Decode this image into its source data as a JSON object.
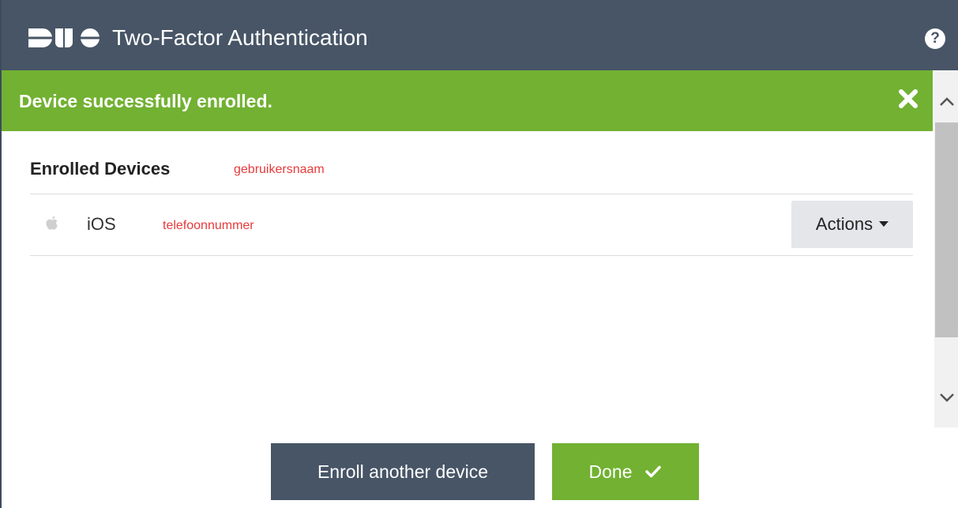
{
  "header": {
    "logo_text": "DUO",
    "title": "Two-Factor Authentication",
    "help_icon": "question-circle-icon",
    "help_symbol": "?"
  },
  "notification": {
    "message": "Device successfully enrolled.",
    "close_icon": "close-icon"
  },
  "devices": {
    "heading": "Enrolled Devices",
    "username_note": "gebruikersnaam",
    "items": [
      {
        "icon": "apple-icon",
        "name": "iOS",
        "note": "telefoonnummer",
        "actions_label": "Actions"
      }
    ]
  },
  "footer": {
    "enroll_label": "Enroll another device",
    "done_label": "Done",
    "done_icon": "check-icon"
  },
  "colors": {
    "header_bg": "#475566",
    "success_green": "#72b132",
    "annotation_red": "#e83a3a",
    "actions_bg": "#e5e6e9"
  }
}
